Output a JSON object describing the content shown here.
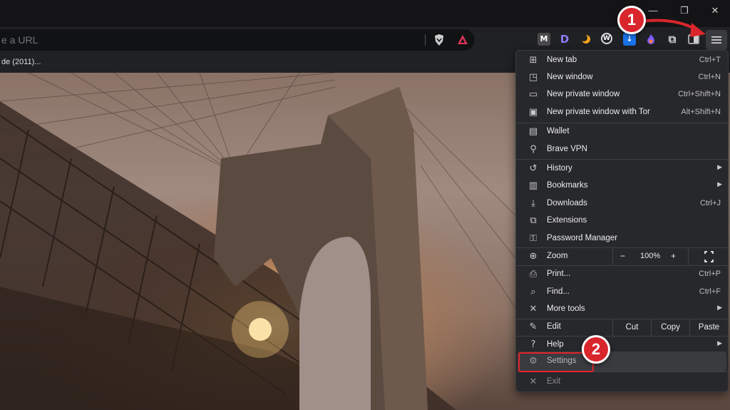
{
  "window": {
    "minimize_glyph": "—",
    "restore_glyph": "❐",
    "close_glyph": "✕"
  },
  "omnibox": {
    "placeholder": "e a URL"
  },
  "bookmarks_bar": {
    "item": "de (2011)..."
  },
  "menu": {
    "items": [
      {
        "id": "new-tab",
        "label": "New tab",
        "shortcut": "Ctrl+T",
        "icon": "new-tab-icon"
      },
      {
        "id": "new-window",
        "label": "New window",
        "shortcut": "Ctrl+N",
        "icon": "new-window-icon"
      },
      {
        "id": "new-private-window",
        "label": "New private window",
        "shortcut": "Ctrl+Shift+N",
        "icon": "private-window-icon"
      },
      {
        "id": "new-private-window-tor",
        "label": "New private window with Tor",
        "shortcut": "Alt+Shift+N",
        "icon": "tor-window-icon"
      },
      {
        "id": "wallet",
        "label": "Wallet",
        "shortcut": "",
        "icon": "wallet-icon"
      },
      {
        "id": "brave-vpn",
        "label": "Brave VPN",
        "shortcut": "",
        "icon": "vpn-icon"
      },
      {
        "id": "history",
        "label": "History",
        "shortcut": "",
        "icon": "history-icon"
      },
      {
        "id": "bookmarks",
        "label": "Bookmarks",
        "shortcut": "",
        "icon": "bookmarks-icon"
      },
      {
        "id": "downloads",
        "label": "Downloads",
        "shortcut": "Ctrl+J",
        "icon": "downloads-icon"
      },
      {
        "id": "extensions",
        "label": "Extensions",
        "shortcut": "",
        "icon": "extensions-icon"
      },
      {
        "id": "password-manager",
        "label": "Password Manager",
        "shortcut": "",
        "icon": "key-icon"
      },
      {
        "id": "zoom",
        "label": "Zoom",
        "shortcut": "",
        "icon": "zoom-icon"
      },
      {
        "id": "print",
        "label": "Print...",
        "shortcut": "Ctrl+P",
        "icon": "print-icon"
      },
      {
        "id": "find",
        "label": "Find...",
        "shortcut": "Ctrl+F",
        "icon": "find-icon"
      },
      {
        "id": "more-tools",
        "label": "More tools",
        "shortcut": "",
        "icon": "tools-icon"
      },
      {
        "id": "edit",
        "label": "Edit",
        "shortcut": "",
        "icon": "edit-icon"
      },
      {
        "id": "help",
        "label": "Help",
        "shortcut": "",
        "icon": "help-icon"
      },
      {
        "id": "settings",
        "label": "Settings",
        "shortcut": "",
        "icon": "gear-icon"
      },
      {
        "id": "exit",
        "label": "Exit",
        "shortcut": "",
        "icon": "close-icon"
      }
    ],
    "zoom": {
      "minus": "−",
      "value": "100%",
      "plus": "+"
    },
    "edit": {
      "cut": "Cut",
      "copy": "Copy",
      "paste": "Paste"
    }
  },
  "annotations": {
    "badge1": "1",
    "badge2": "2"
  },
  "colors": {
    "annotation_red": "#d9262c",
    "menu_bg": "#27282b"
  }
}
